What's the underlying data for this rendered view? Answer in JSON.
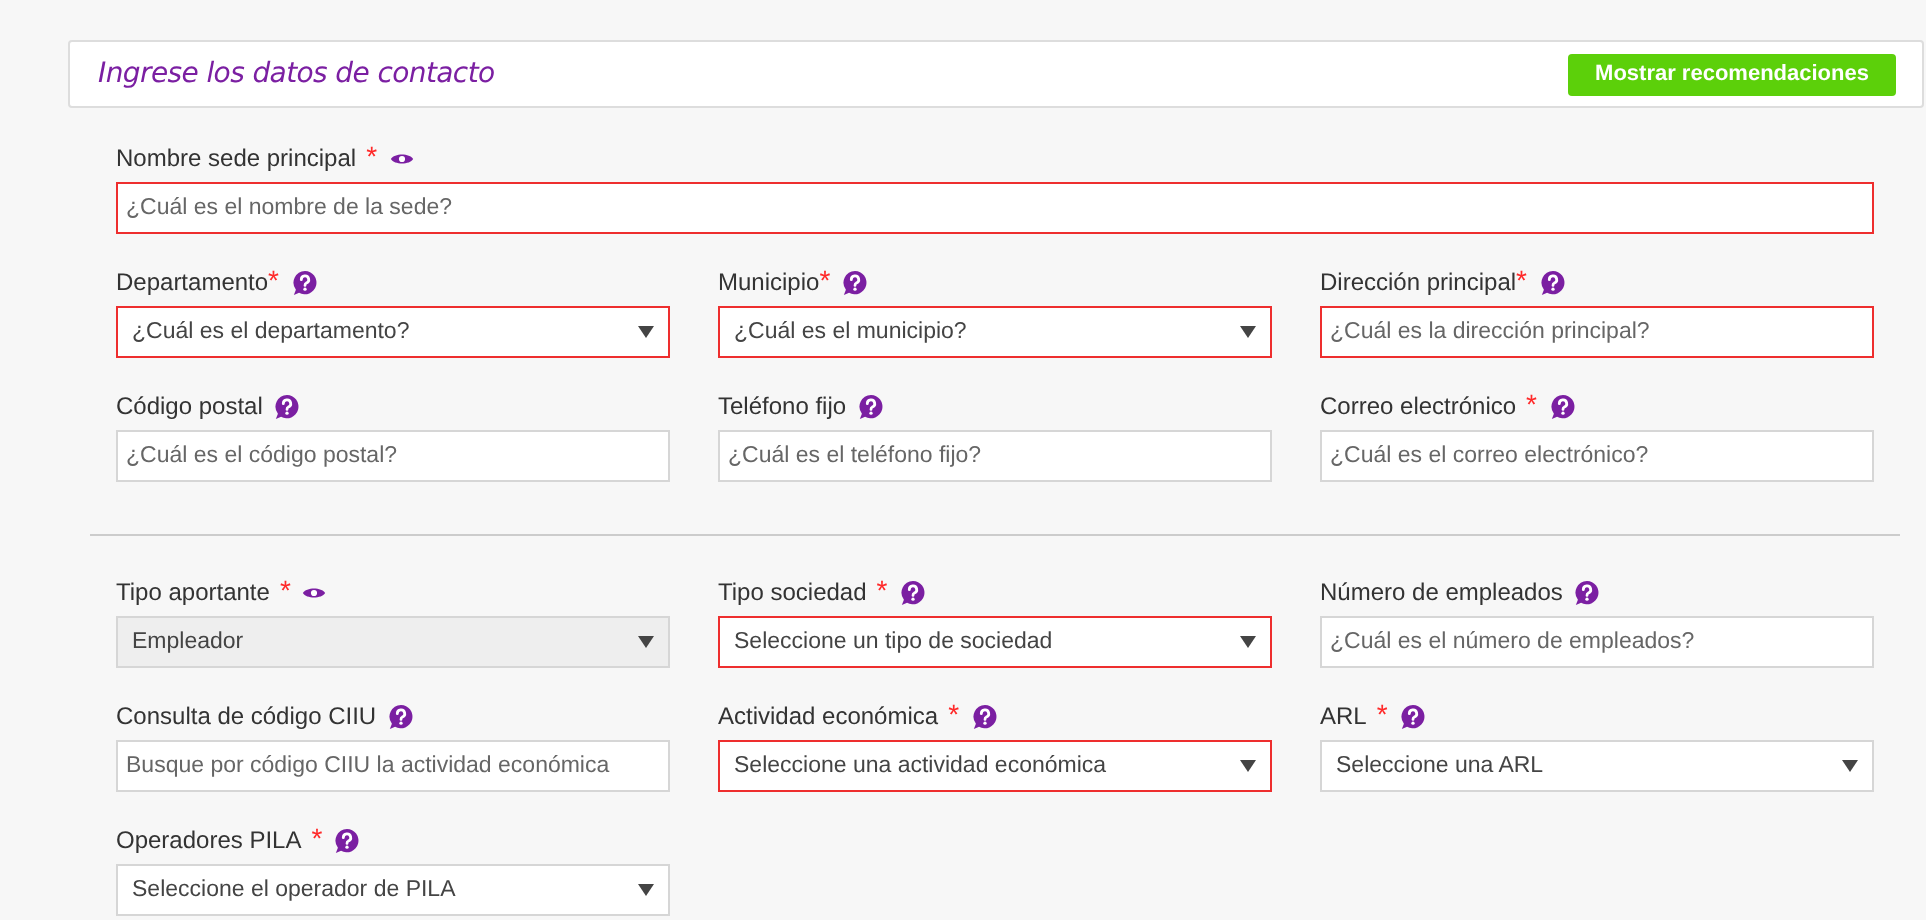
{
  "header": {
    "title": "Ingrese los datos de contacto",
    "button": "Mostrar recomendaciones"
  },
  "sections": [
    {
      "fields": [
        {
          "label": "Nombre sede principal",
          "required_mark": "*",
          "mark_gap": true,
          "help": {
            "kind": "eye"
          },
          "kind": "text",
          "full_width": true,
          "invalid": true,
          "disabled": false,
          "placeholder": "¿Cuál es el nombre de la sede?"
        },
        {
          "label": "Departamento",
          "required_mark": "*",
          "mark_gap": false,
          "help": {
            "kind": "question"
          },
          "kind": "select",
          "full_width": false,
          "invalid": true,
          "disabled": false,
          "value": "¿Cuál es el departamento?"
        },
        {
          "label": "Municipio",
          "required_mark": "*",
          "mark_gap": false,
          "help": {
            "kind": "question"
          },
          "kind": "select",
          "full_width": false,
          "invalid": true,
          "disabled": false,
          "value": "¿Cuál es el municipio?"
        },
        {
          "label": "Dirección principal",
          "required_mark": "*",
          "mark_gap": false,
          "help": {
            "kind": "question"
          },
          "kind": "text",
          "full_width": false,
          "invalid": true,
          "disabled": false,
          "placeholder": "¿Cuál es la dirección principal?"
        },
        {
          "label": "Código postal",
          "help": {
            "kind": "question"
          },
          "kind": "text",
          "full_width": false,
          "invalid": false,
          "disabled": false,
          "placeholder": "¿Cuál es el código postal?"
        },
        {
          "label": "Teléfono fijo",
          "help": {
            "kind": "question"
          },
          "kind": "text",
          "full_width": false,
          "invalid": false,
          "disabled": false,
          "placeholder": "¿Cuál es el teléfono fijo?"
        },
        {
          "label": "Correo electrónico",
          "required_mark": "*",
          "mark_gap": true,
          "help": {
            "kind": "question"
          },
          "kind": "text",
          "full_width": false,
          "invalid": false,
          "disabled": false,
          "placeholder": "¿Cuál es el correo electrónico?"
        }
      ]
    },
    {
      "fields": [
        {
          "label": "Tipo aportante",
          "required_mark": "*",
          "mark_gap": true,
          "help": {
            "kind": "eye"
          },
          "kind": "select",
          "full_width": false,
          "invalid": false,
          "disabled": true,
          "value": "Empleador"
        },
        {
          "label": "Tipo sociedad",
          "required_mark": "*",
          "mark_gap": true,
          "help": {
            "kind": "question"
          },
          "kind": "select",
          "full_width": false,
          "invalid": true,
          "disabled": false,
          "value": "Seleccione un tipo de sociedad"
        },
        {
          "label": "Número de empleados",
          "help": {
            "kind": "question"
          },
          "kind": "text",
          "full_width": false,
          "invalid": false,
          "disabled": false,
          "placeholder": "¿Cuál es el número de empleados?"
        },
        {
          "label": "Consulta de código CIIU",
          "help": {
            "kind": "question"
          },
          "kind": "text",
          "full_width": false,
          "invalid": false,
          "disabled": false,
          "placeholder": "Busque por código CIIU la actividad económica"
        },
        {
          "label": "Actividad económica",
          "required_mark": "*",
          "mark_gap": true,
          "help": {
            "kind": "question"
          },
          "kind": "select",
          "full_width": false,
          "invalid": true,
          "disabled": false,
          "value": "Seleccione una actividad económica"
        },
        {
          "label": "ARL",
          "required_mark": "*",
          "mark_gap": true,
          "help": {
            "kind": "question"
          },
          "kind": "select",
          "full_width": false,
          "invalid": false,
          "disabled": false,
          "value": "Seleccione una ARL"
        },
        {
          "label": "Operadores PILA",
          "required_mark": "*",
          "mark_gap": true,
          "help": {
            "kind": "question"
          },
          "kind": "select",
          "full_width": false,
          "invalid": false,
          "disabled": false,
          "value": "Seleccione el operador de PILA"
        }
      ]
    }
  ]
}
